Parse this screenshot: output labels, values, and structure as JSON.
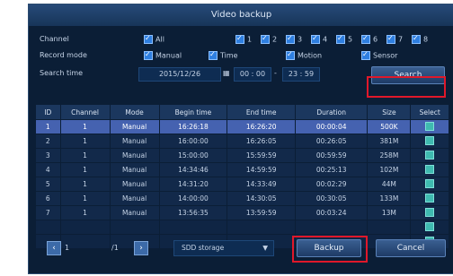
{
  "window": {
    "title": "Video backup"
  },
  "filters": {
    "channel_label": "Channel",
    "channel_all": "All",
    "channels": [
      "1",
      "2",
      "3",
      "4",
      "5",
      "6",
      "7",
      "8"
    ],
    "record_mode_label": "Record mode",
    "modes": [
      "Manual",
      "Time",
      "Motion",
      "Sensor"
    ],
    "search_time_label": "Search time",
    "date": "2015/12/26",
    "time_start": "00 : 00",
    "time_end": "23 : 59",
    "search_button": "Search"
  },
  "table": {
    "headers": [
      "ID",
      "Channel",
      "Mode",
      "Begin time",
      "End time",
      "Duration",
      "Size",
      "Select"
    ],
    "rows": [
      [
        "1",
        "1",
        "Manual",
        "16:26:18",
        "16:26:20",
        "00:00:04",
        "500K"
      ],
      [
        "2",
        "1",
        "Manual",
        "16:00:00",
        "16:26:05",
        "00:26:05",
        "381M"
      ],
      [
        "3",
        "1",
        "Manual",
        "15:00:00",
        "15:59:59",
        "00:59:59",
        "258M"
      ],
      [
        "4",
        "1",
        "Manual",
        "14:34:46",
        "14:59:59",
        "00:25:13",
        "102M"
      ],
      [
        "5",
        "1",
        "Manual",
        "14:31:20",
        "14:33:49",
        "00:02:29",
        "44M"
      ],
      [
        "6",
        "1",
        "Manual",
        "14:00:00",
        "14:30:05",
        "00:30:05",
        "133M"
      ],
      [
        "7",
        "1",
        "Manual",
        "13:56:35",
        "13:59:59",
        "00:03:24",
        "13M"
      ]
    ]
  },
  "footer": {
    "page_current": "1",
    "page_total": "/1",
    "storage": "SDD storage",
    "backup_button": "Backup",
    "cancel_button": "Cancel"
  },
  "colors": {
    "highlight": "#e0182a",
    "selected_row": "#4562b0",
    "panel": "#0b1e36"
  }
}
